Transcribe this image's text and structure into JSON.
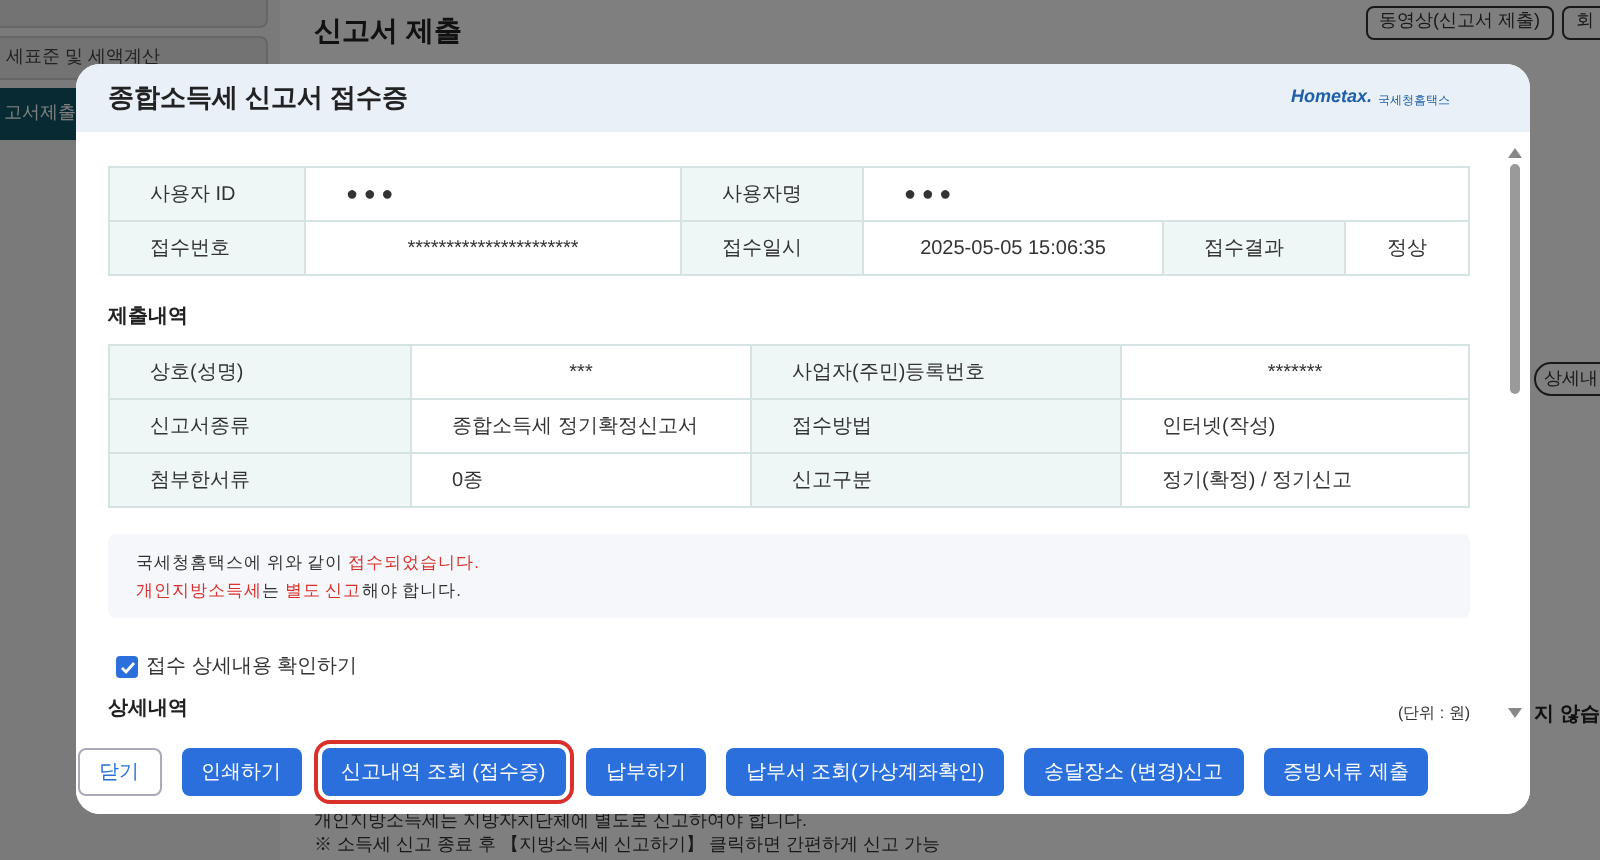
{
  "sidebar": {
    "items": [
      {
        "selected": false
      },
      {
        "label": "세표준 및 세액계산",
        "selected": false
      },
      {
        "label": "고서제출",
        "selected": true
      }
    ]
  },
  "page": {
    "title": "신고서 제출",
    "header_buttons": [
      "동영상(신고서 제출)",
      "회"
    ],
    "side_button": "상세내",
    "side_text": "지 않습",
    "notes": [
      "개인지방소득세는 지방자치단체에 별도로 신고하여야 합니다.",
      "※ 소득세 신고 종료 후 【지방소득세 신고하기】 클릭하면 간편하게 신고 가능"
    ]
  },
  "dialog": {
    "title": "종합소득세 신고서 접수증",
    "logo": {
      "text": "Hometax.",
      "caption": "국세청홈택스"
    },
    "receipt_table": {
      "rows": [
        [
          {
            "kind": "label",
            "text": "사용자 ID"
          },
          {
            "kind": "value",
            "text": "● ● ●"
          },
          {
            "kind": "label",
            "text": "사용자명"
          },
          {
            "kind": "value",
            "text": "● ● ●"
          }
        ],
        [
          {
            "kind": "label",
            "text": "접수번호"
          },
          {
            "kind": "centered_value",
            "text": "**********************"
          },
          {
            "kind": "label",
            "text": "접수일시"
          },
          {
            "kind": "centered_value",
            "text": "2025-05-05 15:06:35"
          },
          {
            "kind": "label",
            "text": "접수결과"
          },
          {
            "kind": "centered_value",
            "text": "정상"
          }
        ]
      ]
    },
    "submission_heading": "제출내역",
    "submission_table": {
      "rows": [
        [
          {
            "kind": "label",
            "text": "상호(성명)"
          },
          {
            "kind": "centered_value",
            "text": "***"
          },
          {
            "kind": "label",
            "text": "사업자(주민)등록번호"
          },
          {
            "kind": "centered_value",
            "text": "*******"
          }
        ],
        [
          {
            "kind": "label",
            "text": "신고서종류"
          },
          {
            "kind": "value",
            "text": "종합소득세 정기확정신고서"
          },
          {
            "kind": "label",
            "text": "접수방법"
          },
          {
            "kind": "value",
            "text": "인터넷(작성)"
          }
        ],
        [
          {
            "kind": "label",
            "text": "첨부한서류"
          },
          {
            "kind": "value",
            "text": "0종"
          },
          {
            "kind": "label",
            "text": "신고구분"
          },
          {
            "kind": "value",
            "text": "정기(확정) / 정기신고"
          }
        ]
      ]
    },
    "notice": [
      [
        {
          "text": "국세청홈택스에 위와 같이 ",
          "emphasis": false
        },
        {
          "text": "접수되었습니다.",
          "emphasis": true
        }
      ],
      [
        {
          "text": "개인지방소득세",
          "emphasis": true
        },
        {
          "text": "는 ",
          "emphasis": false
        },
        {
          "text": "별도 신고",
          "emphasis": true
        },
        {
          "text": "해야 합니다.",
          "emphasis": false
        }
      ]
    ],
    "confirm": {
      "label": "접수 상세내용 확인하기",
      "checked": true
    },
    "details_heading": "상세내역",
    "unit": "(단위 : 원)",
    "buttons": [
      {
        "label": "닫기",
        "kind": "outline",
        "highlighted": false
      },
      {
        "label": "인쇄하기",
        "kind": "primary",
        "highlighted": false
      },
      {
        "label": "신고내역 조회 (접수증)",
        "kind": "primary",
        "highlighted": true
      },
      {
        "label": "납부하기",
        "kind": "primary",
        "highlighted": false
      },
      {
        "label": "납부서 조회(가상계좌확인)",
        "kind": "primary",
        "highlighted": false
      },
      {
        "label": "송달장소 (변경)신고",
        "kind": "primary",
        "highlighted": false
      },
      {
        "label": "증빙서류 제출",
        "kind": "primary",
        "highlighted": false
      }
    ]
  }
}
